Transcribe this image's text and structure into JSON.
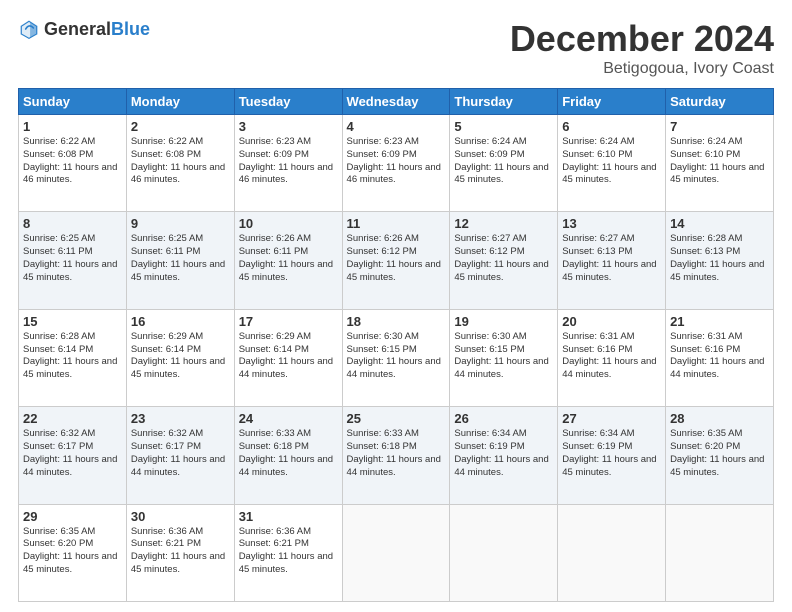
{
  "header": {
    "logo_general": "General",
    "logo_blue": "Blue",
    "month_title": "December 2024",
    "location": "Betigogoua, Ivory Coast"
  },
  "weekdays": [
    "Sunday",
    "Monday",
    "Tuesday",
    "Wednesday",
    "Thursday",
    "Friday",
    "Saturday"
  ],
  "weeks": [
    [
      {
        "day": "1",
        "sunrise": "6:22 AM",
        "sunset": "6:08 PM",
        "daylight": "11 hours and 46 minutes."
      },
      {
        "day": "2",
        "sunrise": "6:22 AM",
        "sunset": "6:08 PM",
        "daylight": "11 hours and 46 minutes."
      },
      {
        "day": "3",
        "sunrise": "6:23 AM",
        "sunset": "6:09 PM",
        "daylight": "11 hours and 46 minutes."
      },
      {
        "day": "4",
        "sunrise": "6:23 AM",
        "sunset": "6:09 PM",
        "daylight": "11 hours and 46 minutes."
      },
      {
        "day": "5",
        "sunrise": "6:24 AM",
        "sunset": "6:09 PM",
        "daylight": "11 hours and 45 minutes."
      },
      {
        "day": "6",
        "sunrise": "6:24 AM",
        "sunset": "6:10 PM",
        "daylight": "11 hours and 45 minutes."
      },
      {
        "day": "7",
        "sunrise": "6:24 AM",
        "sunset": "6:10 PM",
        "daylight": "11 hours and 45 minutes."
      }
    ],
    [
      {
        "day": "8",
        "sunrise": "6:25 AM",
        "sunset": "6:11 PM",
        "daylight": "11 hours and 45 minutes."
      },
      {
        "day": "9",
        "sunrise": "6:25 AM",
        "sunset": "6:11 PM",
        "daylight": "11 hours and 45 minutes."
      },
      {
        "day": "10",
        "sunrise": "6:26 AM",
        "sunset": "6:11 PM",
        "daylight": "11 hours and 45 minutes."
      },
      {
        "day": "11",
        "sunrise": "6:26 AM",
        "sunset": "6:12 PM",
        "daylight": "11 hours and 45 minutes."
      },
      {
        "day": "12",
        "sunrise": "6:27 AM",
        "sunset": "6:12 PM",
        "daylight": "11 hours and 45 minutes."
      },
      {
        "day": "13",
        "sunrise": "6:27 AM",
        "sunset": "6:13 PM",
        "daylight": "11 hours and 45 minutes."
      },
      {
        "day": "14",
        "sunrise": "6:28 AM",
        "sunset": "6:13 PM",
        "daylight": "11 hours and 45 minutes."
      }
    ],
    [
      {
        "day": "15",
        "sunrise": "6:28 AM",
        "sunset": "6:14 PM",
        "daylight": "11 hours and 45 minutes."
      },
      {
        "day": "16",
        "sunrise": "6:29 AM",
        "sunset": "6:14 PM",
        "daylight": "11 hours and 45 minutes."
      },
      {
        "day": "17",
        "sunrise": "6:29 AM",
        "sunset": "6:14 PM",
        "daylight": "11 hours and 44 minutes."
      },
      {
        "day": "18",
        "sunrise": "6:30 AM",
        "sunset": "6:15 PM",
        "daylight": "11 hours and 44 minutes."
      },
      {
        "day": "19",
        "sunrise": "6:30 AM",
        "sunset": "6:15 PM",
        "daylight": "11 hours and 44 minutes."
      },
      {
        "day": "20",
        "sunrise": "6:31 AM",
        "sunset": "6:16 PM",
        "daylight": "11 hours and 44 minutes."
      },
      {
        "day": "21",
        "sunrise": "6:31 AM",
        "sunset": "6:16 PM",
        "daylight": "11 hours and 44 minutes."
      }
    ],
    [
      {
        "day": "22",
        "sunrise": "6:32 AM",
        "sunset": "6:17 PM",
        "daylight": "11 hours and 44 minutes."
      },
      {
        "day": "23",
        "sunrise": "6:32 AM",
        "sunset": "6:17 PM",
        "daylight": "11 hours and 44 minutes."
      },
      {
        "day": "24",
        "sunrise": "6:33 AM",
        "sunset": "6:18 PM",
        "daylight": "11 hours and 44 minutes."
      },
      {
        "day": "25",
        "sunrise": "6:33 AM",
        "sunset": "6:18 PM",
        "daylight": "11 hours and 44 minutes."
      },
      {
        "day": "26",
        "sunrise": "6:34 AM",
        "sunset": "6:19 PM",
        "daylight": "11 hours and 44 minutes."
      },
      {
        "day": "27",
        "sunrise": "6:34 AM",
        "sunset": "6:19 PM",
        "daylight": "11 hours and 45 minutes."
      },
      {
        "day": "28",
        "sunrise": "6:35 AM",
        "sunset": "6:20 PM",
        "daylight": "11 hours and 45 minutes."
      }
    ],
    [
      {
        "day": "29",
        "sunrise": "6:35 AM",
        "sunset": "6:20 PM",
        "daylight": "11 hours and 45 minutes."
      },
      {
        "day": "30",
        "sunrise": "6:36 AM",
        "sunset": "6:21 PM",
        "daylight": "11 hours and 45 minutes."
      },
      {
        "day": "31",
        "sunrise": "6:36 AM",
        "sunset": "6:21 PM",
        "daylight": "11 hours and 45 minutes."
      },
      null,
      null,
      null,
      null
    ]
  ]
}
